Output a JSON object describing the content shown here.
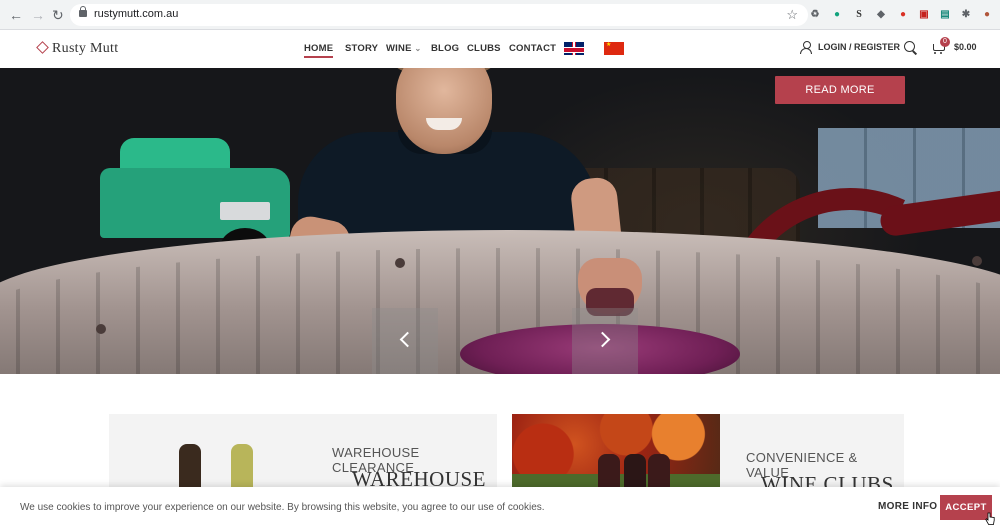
{
  "browser": {
    "url": "rustymutt.com.au",
    "back_icon": "arrow-left-icon",
    "forward_icon": "arrow-right-icon",
    "reload_icon": "reload-icon",
    "back_glyph": "←",
    "forward_glyph": "→",
    "reload_glyph": "↻",
    "star_glyph": "☆",
    "extensions": [
      {
        "icon": "recycle-icon",
        "glyph": "♻",
        "color": "#5f6368"
      },
      {
        "icon": "green-circle-icon",
        "glyph": "●",
        "color": "#12a37d"
      },
      {
        "icon": "s-extension-icon",
        "glyph": "S",
        "color": "#333333"
      },
      {
        "icon": "shield-icon",
        "glyph": "◆",
        "color": "#5f6368"
      },
      {
        "icon": "red-badge-icon",
        "glyph": "●",
        "color": "#d93025"
      },
      {
        "icon": "screen-capture-icon",
        "glyph": "▣",
        "color": "#c5221f"
      },
      {
        "icon": "teal-screen-icon",
        "glyph": "▤",
        "color": "#188a7c"
      },
      {
        "icon": "puzzle-icon",
        "glyph": "✱",
        "color": "#5f6368"
      },
      {
        "icon": "profile-avatar-icon",
        "glyph": "●",
        "color": "#b0553a"
      }
    ]
  },
  "header": {
    "logo_text": "Rusty Mutt",
    "nav": [
      {
        "label": "HOME",
        "active": true
      },
      {
        "label": "STORY",
        "active": false
      },
      {
        "label": "WINE",
        "active": false,
        "has_dropdown": true
      },
      {
        "label": "BLOG",
        "active": false
      },
      {
        "label": "CLUBS",
        "active": false
      },
      {
        "label": "CONTACT",
        "active": false
      }
    ],
    "dropdown_glyph": "⌄",
    "login_label": "LOGIN / REGISTER",
    "cart_count": "0",
    "cart_total": "$0.00"
  },
  "hero": {
    "read_more_label": "READ MORE",
    "prev_icon": "chevron-left-icon",
    "next_icon": "chevron-right-icon"
  },
  "promos": [
    {
      "kicker": "WAREHOUSE CLEARANCE",
      "title": "WAREHOUSE"
    },
    {
      "kicker": "CONVENIENCE & VALUE",
      "title": "WINE CLUBS"
    }
  ],
  "cookie": {
    "message": "We use cookies to improve your experience on our website. By browsing this website, you agree to our use of cookies.",
    "more_info_label": "MORE INFO",
    "accept_label": "ACCEPT"
  },
  "colors": {
    "accent": "#b5414d",
    "header_text": "#333333",
    "hero_dark": "#131418"
  }
}
